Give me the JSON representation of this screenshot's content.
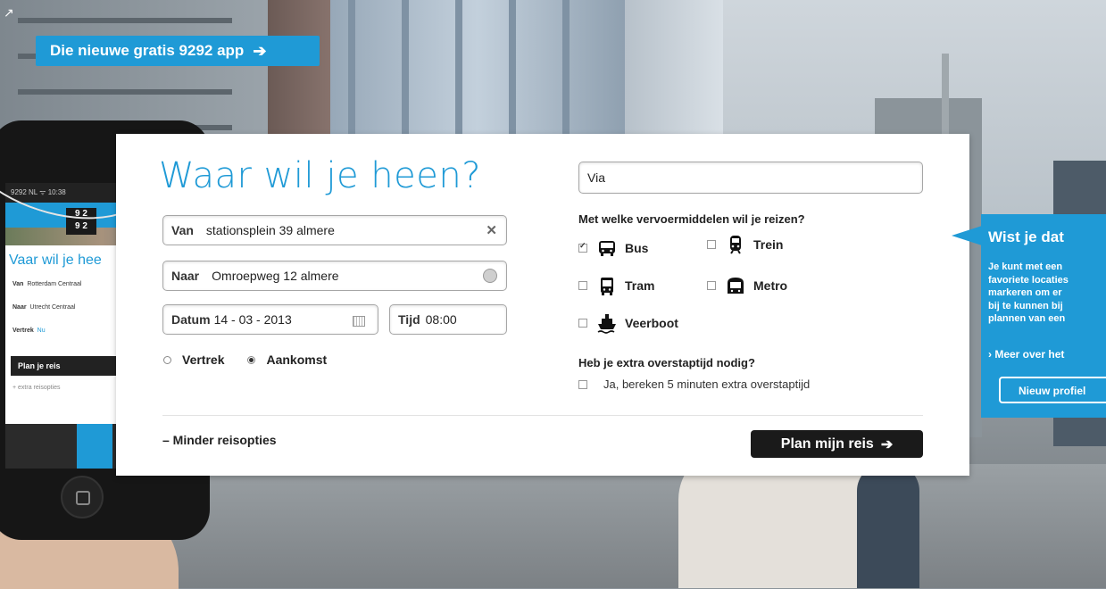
{
  "banner": {
    "label": "Die nieuwe gratis 9292 app",
    "arrow": "➔"
  },
  "form": {
    "title": "Waar wil je heen?",
    "van": {
      "label": "Van",
      "value": "stationsplein 39 almere",
      "clear": "✕"
    },
    "naar": {
      "label": "Naar",
      "value": "Omroepweg 12 almere"
    },
    "datum": {
      "label": "Datum",
      "value": "14 - 03 - 2013"
    },
    "tijd": {
      "label": "Tijd",
      "value": "08:00"
    },
    "vertrek_label": "Vertrek",
    "aankomst_label": "Aankomst",
    "selected_mode": "Aankomst",
    "via_placeholder": "Via",
    "transport_question": "Met welke vervoermiddelen wil je reizen?",
    "transport": [
      {
        "label": "Bus",
        "checked": true,
        "icon": "bus-icon"
      },
      {
        "label": "Trein",
        "checked": false,
        "icon": "train-icon"
      },
      {
        "label": "Tram",
        "checked": false,
        "icon": "tram-icon"
      },
      {
        "label": "Metro",
        "checked": false,
        "icon": "metro-icon"
      },
      {
        "label": "Veerboot",
        "checked": false,
        "icon": "ferry-icon"
      }
    ],
    "transfer_question": "Heb je extra overstaptijd nodig?",
    "transfer_option": "Ja, bereken 5 minuten extra overstaptijd",
    "transfer_checked": false,
    "less_options": "– Minder reisopties",
    "plan_button": "Plan mijn reis",
    "plan_arrow": "➔"
  },
  "tip": {
    "title": "Wist je dat",
    "lines": [
      "Je kunt met een",
      "favoriete locaties",
      "markeren om er",
      "bij te kunnen bij",
      "plannen van een"
    ],
    "link": "› Meer over het",
    "button": "Nieuw profiel"
  },
  "phone": {
    "badge": "9 2\n9 2",
    "status": "9292 NL  ᯤ  10:38",
    "title": "Vaar wil je hee",
    "rows": [
      {
        "label": "Van",
        "value": "Rotterdam Centraal"
      },
      {
        "label": "Naar",
        "value": "Utrecht Centraal"
      },
      {
        "label": "Vertrek",
        "value": "Nu"
      }
    ],
    "plan_button": "Plan je reis",
    "extra_link": "+ extra reisopties"
  },
  "colors": {
    "accent": "#1f9ad6",
    "dark": "#1a1a1a",
    "panel": "#ffffff"
  }
}
